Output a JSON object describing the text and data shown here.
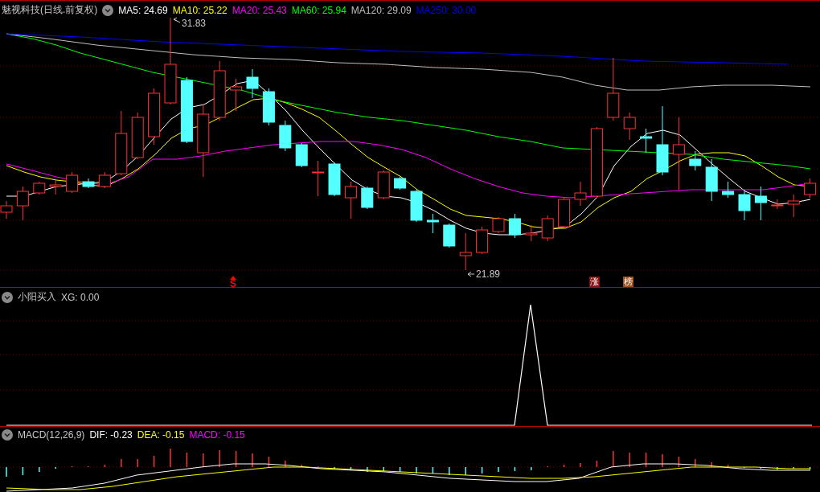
{
  "main_panel": {
    "title": "魅视科技(日线.前复权)",
    "ma_readings": [
      {
        "text": "MA5: 24.69",
        "color": "#ffffff"
      },
      {
        "text": "MA10: 25.22",
        "color": "#ffff00"
      },
      {
        "text": "MA20: 25.43",
        "color": "#ff00ff"
      },
      {
        "text": "MA60: 25.94",
        "color": "#00ff00"
      },
      {
        "text": "MA120: 29.09",
        "color": "#c0c0c0"
      },
      {
        "text": "MA250: 30.00",
        "color": "#0000ff"
      }
    ],
    "high_label": "31.83",
    "low_label": "21.89",
    "signals": [
      {
        "text": "S",
        "kind": "arrow",
        "color": "#ff0000"
      },
      {
        "text": "涨",
        "kind": "box",
        "color": "#8b1010"
      },
      {
        "text": "榜",
        "kind": "box",
        "color": "#a0501c"
      }
    ]
  },
  "indicator_panel": {
    "title": "小阳买入",
    "reading": "XG: 0.00"
  },
  "macd_panel": {
    "title": "MACD(12,26,9)",
    "readings": [
      {
        "text": "DIF: -0.23",
        "color": "#ffffff"
      },
      {
        "text": "DEA: -0.15",
        "color": "#ffff00"
      },
      {
        "text": "MACD: -0.15",
        "color": "#ff00ff"
      }
    ]
  }
}
